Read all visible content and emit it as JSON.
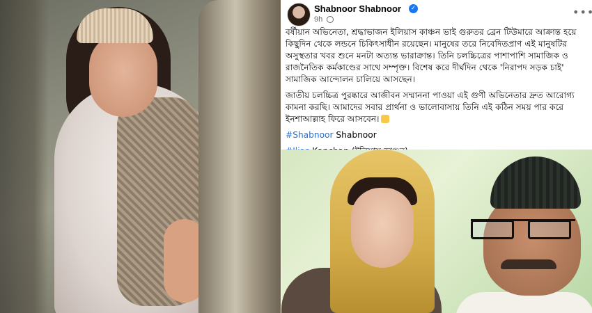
{
  "post": {
    "author": "Shabnoor Shabnoor",
    "time": "9h",
    "more": "•••",
    "paragraph1": "বর্ষীয়ান অভিনেতা, শ্রদ্ধাভাজন ইলিয়াস কাঞ্চন ভাই গুরুতর ব্রেন টিউমারে আক্রান্ত হয়ে কিছুদিন থেকে লন্ডনে চিকিৎসাধীন রয়েছেন। মানুষের তরে নিবেদিতপ্রাণ এই মানুষটির অসুস্থতার খবর শুনে মনটা অত্যন্ত ভারাক্রান্ত। তিনি চলচ্চিত্রের পাশাপাশি সামাজিক ও রাজনৈতিক কর্মকাণ্ডের সাথে সম্পৃক্ত। বিশেষ করে দীর্ঘদিন থেকে 'নিরাপদ সড়ক চাই' সামাজিক আন্দোলন চালিয়ে আসছেন।",
    "paragraph2": "জাতীয় চলচ্চিত্র পুরষ্কারে আজীবন সম্মাননা পাওয়া এই গুণী অভিনেতার দ্রুত আরোগ্য কামনা করছি। আমাদের সবার প্রার্থনা ও ভালোবাসায় তিনি এই কঠিন সময় পার করে ইনশাআল্লাহ ফিরে আসবেন।",
    "hashtag1": "#Shabnoor",
    "hashtag1_rest": " Shabnoor",
    "hashtag2": "#Ilias",
    "hashtag2_rest": " Kanchan (ইলিয়াস কাঞ্চন)"
  },
  "icons": {
    "verified": "verified-badge-icon",
    "globe": "globe-icon",
    "wave": "clapping-hands-emoji"
  },
  "colors": {
    "hashtag": "#216fdb",
    "verified": "#1877f2",
    "meta": "#65676b"
  }
}
